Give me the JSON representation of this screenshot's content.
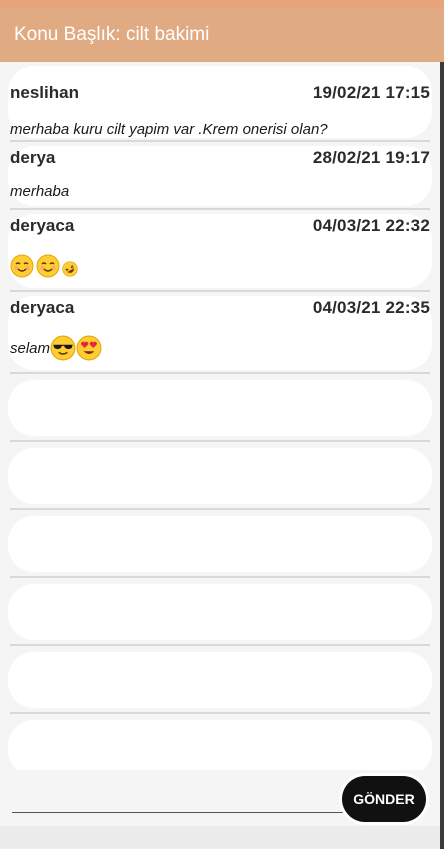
{
  "header": {
    "title": "Konu Başlık: cilt bakimi"
  },
  "messages": [
    {
      "user": "neslihan",
      "datetime": "19/02/21 17:15",
      "text": "merhaba kuru cilt yapim var .Krem onerisi olan?"
    },
    {
      "user": "derya",
      "datetime": "28/02/21 19:17",
      "text": "merhaba"
    },
    {
      "user": "deryaca",
      "datetime": "04/03/21 22:32",
      "text": "",
      "emojis": [
        "smiling-blush",
        "smiling-blush",
        "rofl-small"
      ]
    },
    {
      "user": "deryaca",
      "datetime": "04/03/21 22:35",
      "text": "selam",
      "emojis": [
        "sunglasses",
        "heart-eyes"
      ]
    }
  ],
  "composer": {
    "placeholder": "",
    "send_label": "GÖNDER"
  },
  "colors": {
    "app_bar": "#e0ab83",
    "status_strip": "#e7a37a",
    "send_button": "#111111"
  }
}
